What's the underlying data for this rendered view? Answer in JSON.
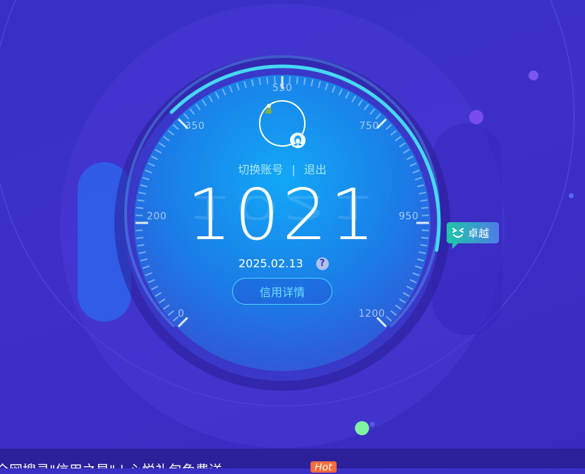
{
  "gauge": {
    "tick_labels": [
      "0",
      "200",
      "350",
      "550",
      "750",
      "950",
      "1200"
    ]
  },
  "account": {
    "switch_label": "切换账号",
    "separator": "|",
    "logout_label": "退出"
  },
  "score": {
    "value": "1021",
    "date": "2025.02.13",
    "help_icon_text": "?",
    "detail_label": "信用详情"
  },
  "level_badge": {
    "label": "卓越"
  },
  "promo": {
    "text": "全网搜寻\"信用之星\" | 心悦礼包免费送",
    "hot_label": "Hot"
  },
  "colors": {
    "background": "#3a2fc4",
    "gauge_inner": "#0a8ff0",
    "accent_cyan": "#4fd3ff",
    "badge_start": "#1ec7a8",
    "badge_end": "#4f7ce8",
    "hot": "#ff6a3d"
  }
}
